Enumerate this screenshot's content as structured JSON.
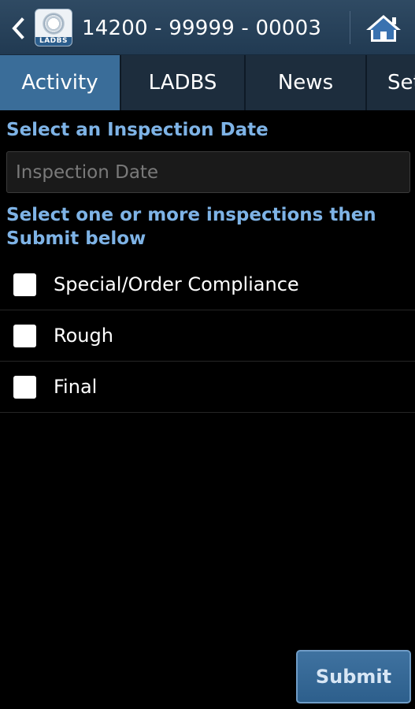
{
  "appbar": {
    "logo_text": "LADBS",
    "title": "14200 - 99999 - 00003"
  },
  "tabs": [
    {
      "label": "Activity",
      "active": true
    },
    {
      "label": "LADBS",
      "active": false
    },
    {
      "label": "News",
      "active": false
    },
    {
      "label": "Set",
      "active": false
    }
  ],
  "form": {
    "date_label": "Select an Inspection Date",
    "date_placeholder": "Inspection Date",
    "date_value": "",
    "inspections_label": "Select one or more inspections then Submit below",
    "inspections": [
      {
        "label": "Special/Order Compliance",
        "checked": false
      },
      {
        "label": "Rough",
        "checked": false
      },
      {
        "label": "Final",
        "checked": false
      }
    ],
    "submit_label": "Submit"
  },
  "colors": {
    "appbar": "#2a455d",
    "tab_active": "#3a6d99",
    "label_blue": "#7eb3e6",
    "background": "#000000"
  }
}
